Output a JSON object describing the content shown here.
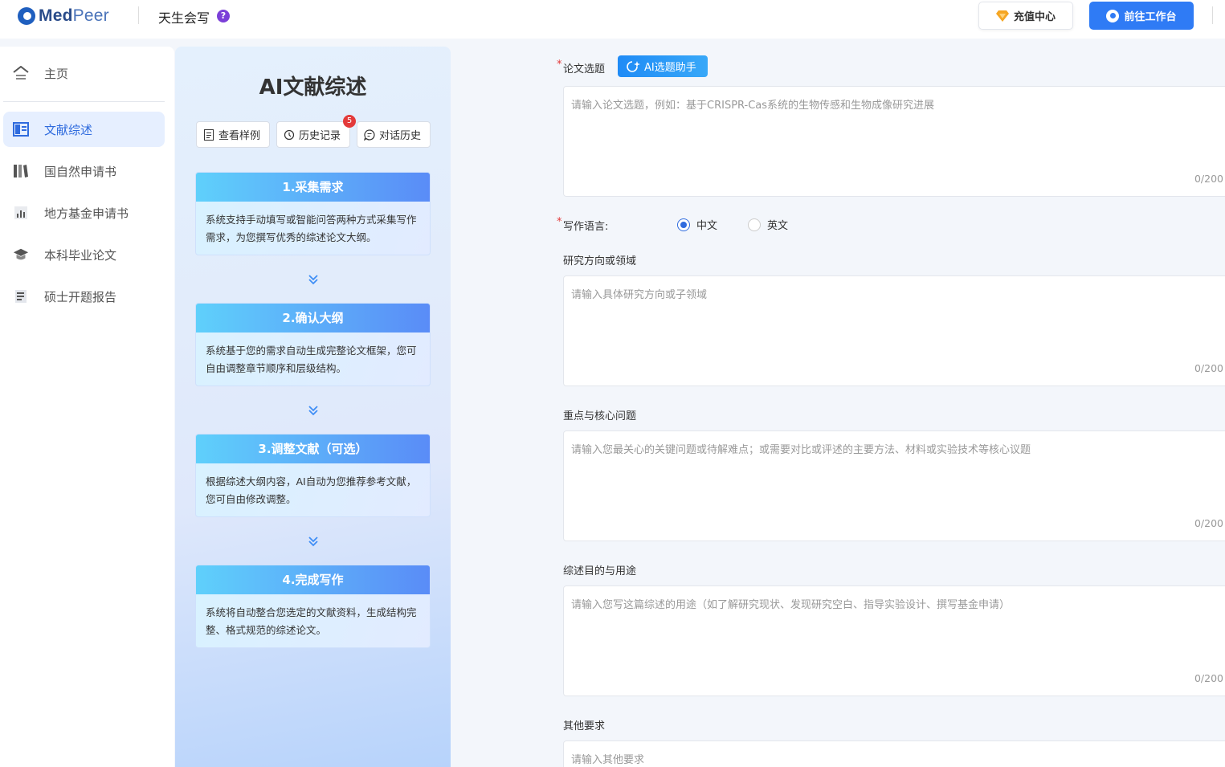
{
  "header": {
    "brand": "MedPeer",
    "brand_med": "Med",
    "brand_peer": "Peer",
    "app_name": "天生会写",
    "help_label": "?",
    "recharge_label": "充值中心",
    "workspace_label": "前往工作台",
    "colors": {
      "primary": "#2f7bf5",
      "brand": "#2a4c8a"
    }
  },
  "sidebar": {
    "items": [
      {
        "label": "主页",
        "icon": "home-icon"
      },
      {
        "label": "文献综述",
        "icon": "review-icon",
        "active": true
      },
      {
        "label": "国自然申请书",
        "icon": "books-icon"
      },
      {
        "label": "地方基金申请书",
        "icon": "chart-doc-icon"
      },
      {
        "label": "本科毕业论文",
        "icon": "graduation-cap-icon"
      },
      {
        "label": "硕士开题报告",
        "icon": "report-icon"
      }
    ]
  },
  "panel": {
    "title": "AI文献综述",
    "actions": [
      {
        "label": "查看样例",
        "icon": "document-icon"
      },
      {
        "label": "历史记录",
        "icon": "history-icon",
        "badge": "5"
      },
      {
        "label": "对话历史",
        "icon": "chat-icon"
      }
    ],
    "steps": [
      {
        "title": "1.采集需求",
        "desc": "系统支持手动填写或智能问答两种方式采集写作需求，为您撰写优秀的综述论文大纲。"
      },
      {
        "title": "2.确认大纲",
        "desc": "系统基于您的需求自动生成完整论文框架，您可自由调整章节顺序和层级结构。"
      },
      {
        "title": "3.调整文献（可选）",
        "desc": "根据综述大纲内容，AI自动为您推荐参考文献，您可自由修改调整。"
      },
      {
        "title": "4.完成写作",
        "desc": "系统将自动整合您选定的文献资料，生成结构完整、格式规范的综述论文。"
      }
    ]
  },
  "form": {
    "required_mark": "*",
    "topic": {
      "label": "论文选题",
      "ai_button": "AI选题助手",
      "placeholder": "请输入论文选题，例如：基于CRISPR-Cas系统的生物传感和生物成像研究进展",
      "counter": "0/200"
    },
    "language": {
      "label": "写作语言:",
      "options": [
        "中文",
        "英文"
      ],
      "selected": "中文"
    },
    "direction": {
      "label": "研究方向或领域",
      "placeholder": "请输入具体研究方向或子领域",
      "counter": "0/200"
    },
    "key_issues": {
      "label": "重点与核心问题",
      "placeholder": "请输入您最关心的关键问题或待解难点；或需要对比或评述的主要方法、材料或实验技术等核心议题",
      "counter": "0/200"
    },
    "purpose": {
      "label": "综述目的与用途",
      "placeholder": "请输入您写这篇综述的用途（如了解研究现状、发现研究空白、指导实验设计、撰写基金申请）",
      "counter": "0/200"
    },
    "other": {
      "label": "其他要求",
      "placeholder": "请输入其他要求"
    }
  }
}
